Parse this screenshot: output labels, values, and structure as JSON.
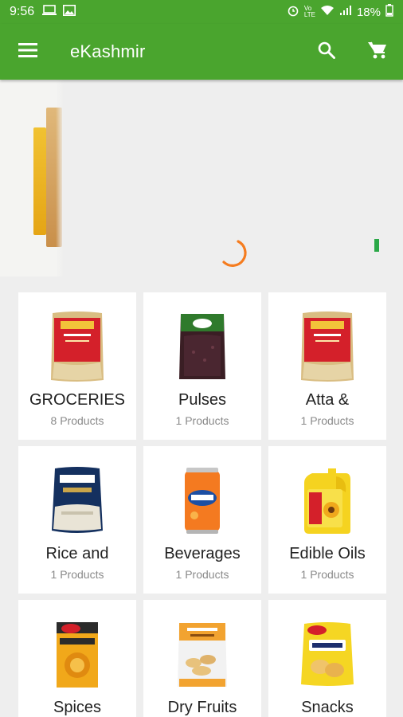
{
  "status_bar": {
    "time": "9:56",
    "icons_left": [
      "laptop-icon",
      "image-icon"
    ],
    "icons_right": [
      "alarm-icon",
      "volte-icon",
      "wifi-icon",
      "signal-icon",
      "signal-icon"
    ],
    "battery": "18%"
  },
  "app_bar": {
    "title": "eKashmir",
    "color": "#4aa52e",
    "menu_icon": "menu-icon",
    "search_icon": "search-icon",
    "cart_icon": "cart-icon"
  },
  "banner": {
    "loading_color": "#f57c1f",
    "indicator_color": "#2aa847"
  },
  "categories": [
    {
      "name": "GROCERIES",
      "count": "8 Products",
      "icon": "flour-bag"
    },
    {
      "name": "Pulses",
      "count": "1 Products",
      "icon": "pulse-pack"
    },
    {
      "name": "Atta &",
      "count": "1 Products",
      "icon": "flour-bag"
    },
    {
      "name": "Rice and",
      "count": "1 Products",
      "icon": "rice-bag"
    },
    {
      "name": "Beverages",
      "count": "1 Products",
      "icon": "soda-can"
    },
    {
      "name": "Edible Oils",
      "count": "1 Products",
      "icon": "oil-can"
    },
    {
      "name": "Spices",
      "count": "",
      "icon": "spice-box"
    },
    {
      "name": "Dry Fruits",
      "count": "",
      "icon": "cashew-pack"
    },
    {
      "name": "Snacks",
      "count": "",
      "icon": "chips-pack"
    }
  ]
}
